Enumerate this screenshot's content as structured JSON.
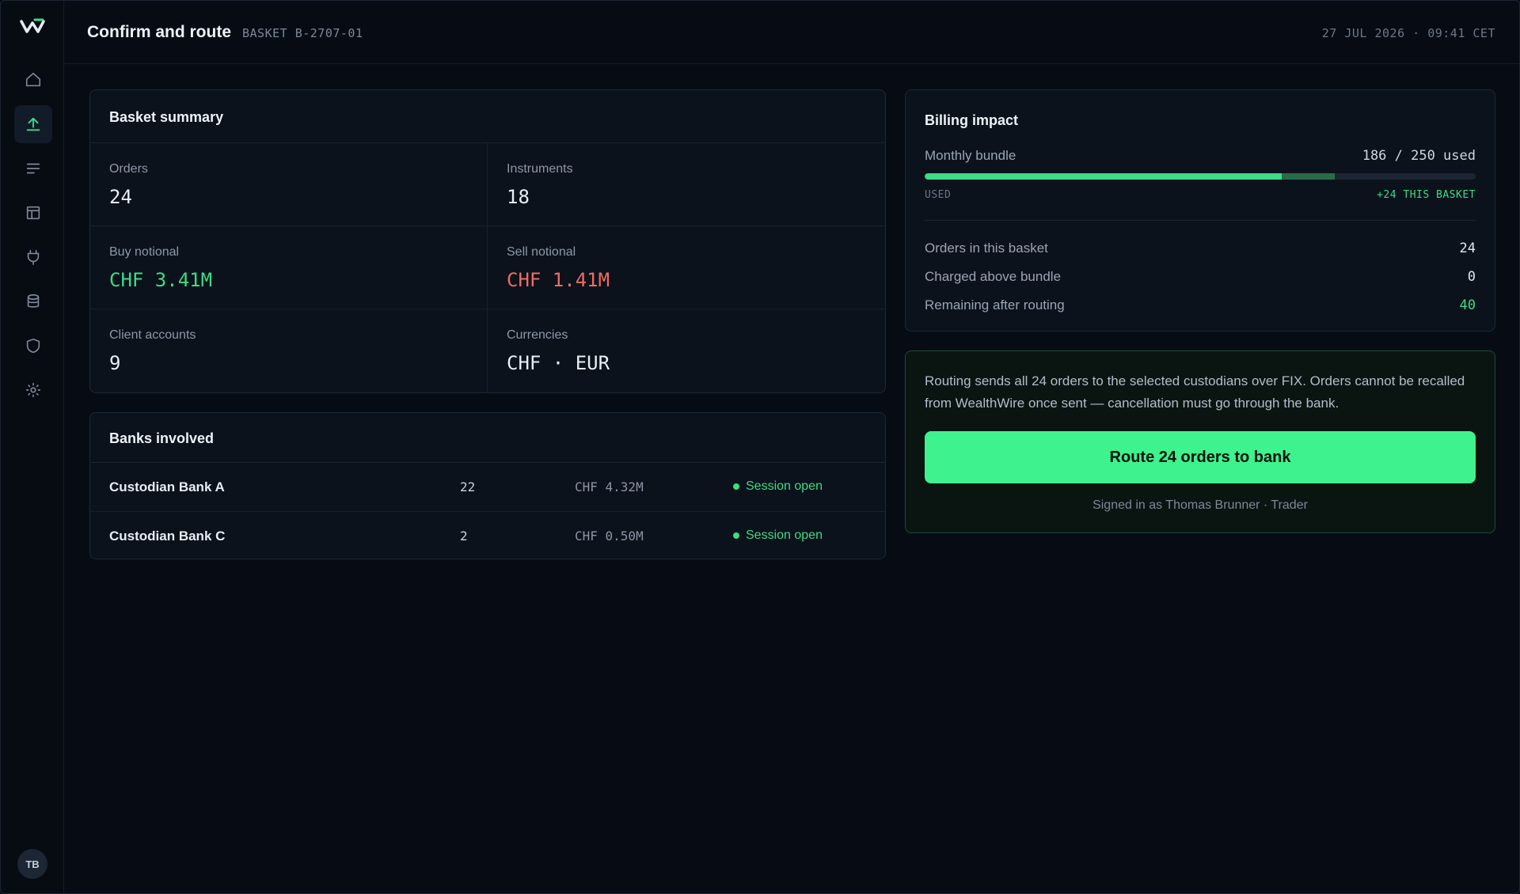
{
  "app": {
    "brand_color": "#3ddc84"
  },
  "header": {
    "title": "Confirm and route",
    "basket_id": "BASKET B-2707-01",
    "datetime": "27 JUL 2026 · 09:41 CET"
  },
  "sidebar": {
    "items": [
      {
        "icon": "home-icon",
        "active": false
      },
      {
        "icon": "upload-icon",
        "active": true
      },
      {
        "icon": "list-icon",
        "active": false
      },
      {
        "icon": "layout-icon",
        "active": false
      },
      {
        "icon": "plug-icon",
        "active": false
      },
      {
        "icon": "database-icon",
        "active": false
      },
      {
        "icon": "shield-icon",
        "active": false
      },
      {
        "icon": "settings-icon",
        "active": false
      }
    ],
    "avatar_initials": "TB"
  },
  "summary": {
    "title": "Basket summary",
    "orders_label": "Orders",
    "orders_value": "24",
    "instruments_label": "Instruments",
    "instruments_value": "18",
    "buy_label": "Buy notional",
    "buy_value": "CHF 3.41M",
    "sell_label": "Sell notional",
    "sell_value": "CHF 1.41M",
    "accounts_label": "Client accounts",
    "accounts_value": "9",
    "currencies_label": "Currencies",
    "currencies_value": "CHF · EUR"
  },
  "banks": {
    "title": "Banks involved",
    "rows": [
      {
        "name": "Custodian Bank A",
        "orders": "22",
        "notional": "CHF 4.32M",
        "status": "Session open"
      },
      {
        "name": "Custodian Bank C",
        "orders": "2",
        "notional": "CHF 0.50M",
        "status": "Session open"
      }
    ]
  },
  "billing": {
    "title": "Billing impact",
    "bundle_label": "Monthly bundle",
    "bundle_used_text": "186 / 250 used",
    "bundle_used": 186,
    "bundle_basket": 24,
    "bundle_total": 250,
    "used_caption": "USED",
    "basket_caption": "+24 THIS BASKET",
    "rows": [
      {
        "label": "Orders in this basket",
        "value": "24"
      },
      {
        "label": "Charged above bundle",
        "value": "0"
      },
      {
        "label": "Remaining after routing",
        "value": "40"
      }
    ]
  },
  "route": {
    "warning": "Routing sends all 24 orders to the selected custodians over FIX. Orders cannot be recalled from WealthWire once sent — cancellation must go through the bank.",
    "button_label": "Route 24 orders to bank",
    "signed_in": "Signed in as Thomas Brunner · Trader"
  }
}
